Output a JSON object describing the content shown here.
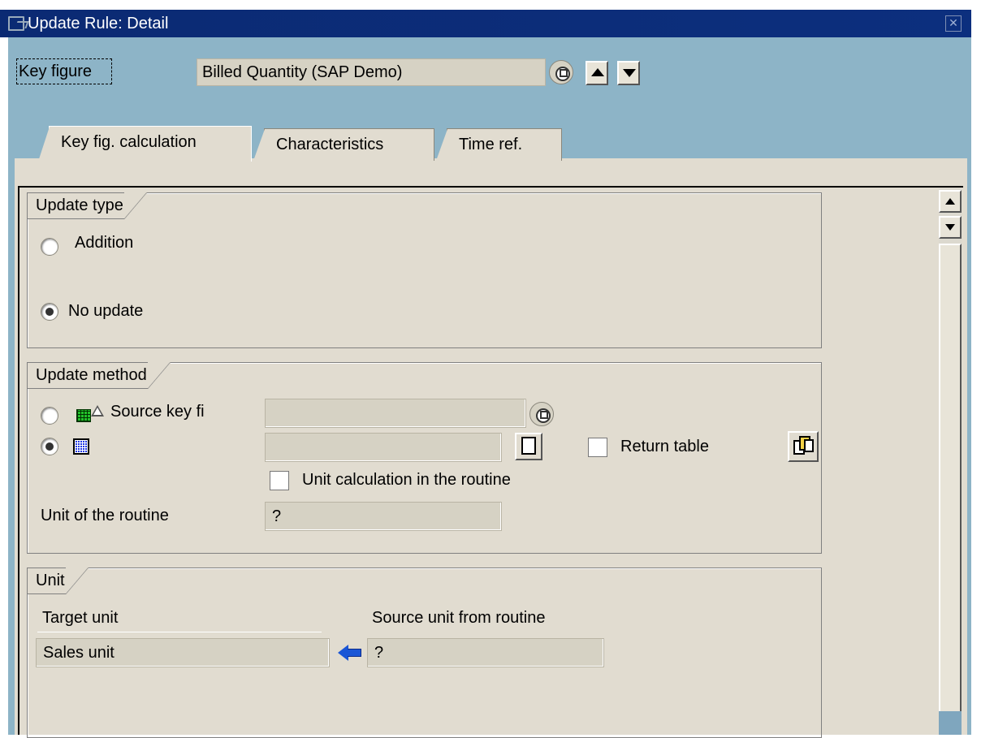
{
  "window": {
    "title": "Update Rule: Detail"
  },
  "header": {
    "key_figure_label": "Key figure",
    "key_figure_value": "Billed Quantity (SAP Demo)"
  },
  "tabs": [
    {
      "label": "Key fig. calculation",
      "active": true
    },
    {
      "label": "Characteristics",
      "active": false
    },
    {
      "label": "Time ref.",
      "active": false
    }
  ],
  "update_type": {
    "title": "Update type",
    "options": [
      {
        "label": "Addition",
        "selected": false
      },
      {
        "label": "No update",
        "selected": true
      }
    ]
  },
  "update_method": {
    "title": "Update method",
    "source_key_figure_label": "Source key fi",
    "source_key_figure_value": "",
    "source_selected": false,
    "routine_selected": true,
    "routine_value": "",
    "return_table_label": "Return table",
    "return_table_checked": false,
    "unit_calc_label": "Unit calculation in the routine",
    "unit_calc_checked": false,
    "unit_of_routine_label": "Unit of the routine",
    "unit_of_routine_value": "?"
  },
  "unit": {
    "title": "Unit",
    "target_unit_label": "Target unit",
    "target_unit_value": "Sales unit",
    "source_unit_label": "Source unit from routine",
    "source_unit_value": "?"
  },
  "colors": {
    "titlebar": "#0b2a73",
    "header_bg": "#8db4c7",
    "panel_bg": "#e1dcd0",
    "field_bg": "#d6d2c4"
  }
}
